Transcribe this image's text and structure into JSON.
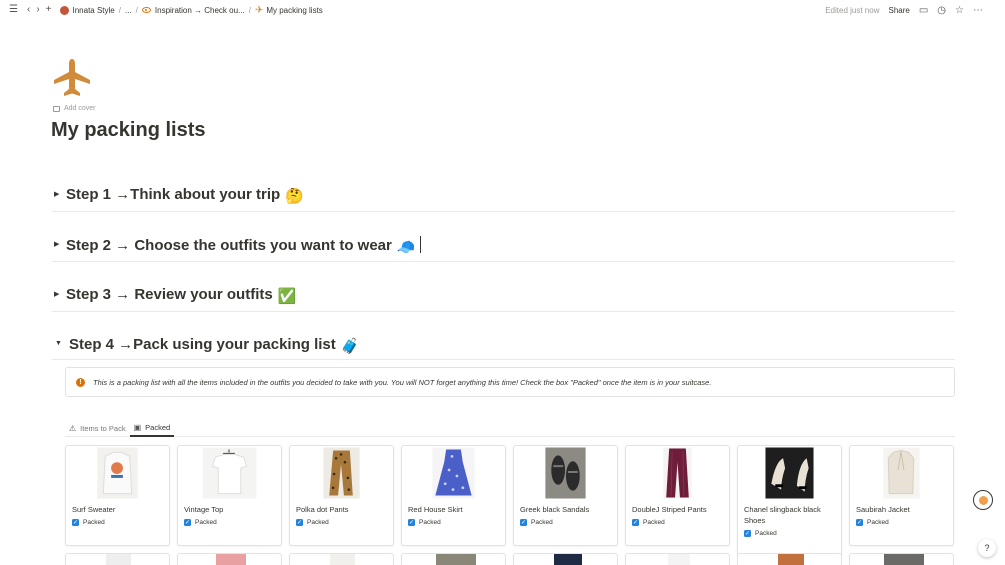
{
  "topbar": {
    "breadcrumbs": [
      "Innata Style",
      "...",
      "Inspiration → Check ou...",
      "My packing lists"
    ],
    "edited": "Edited just now",
    "share": "Share"
  },
  "page": {
    "icon": "airplane-icon",
    "add_cover": "Add cover",
    "title": "My packing lists"
  },
  "toggles": [
    {
      "label": "Step 1 →Think about your trip",
      "emoji": "🤔",
      "open": false
    },
    {
      "label": "Step 2 → Choose the outfits you want to wear",
      "emoji": "🧢",
      "open": false
    },
    {
      "label": "Step 3 → Review your outfits",
      "emoji": "✅",
      "open": false
    },
    {
      "label": "Step 4 →Pack using your packing list",
      "emoji": "🧳",
      "open": true
    }
  ],
  "callout": {
    "text": "This is a packing list with all the items included in the outfits you decided to take with you. You will NOT forget anything this time! Check the box \"Packed\" once the item is in your suitcase."
  },
  "tabs": [
    {
      "label": "Items to Pack",
      "active": false
    },
    {
      "label": "Packed",
      "active": true
    }
  ],
  "cards": [
    {
      "name": "Surf Sweater",
      "packed_label": "Packed",
      "packed": true
    },
    {
      "name": "Vintage Top",
      "packed_label": "Packed",
      "packed": true
    },
    {
      "name": "Polka dot Pants",
      "packed_label": "Packed",
      "packed": true
    },
    {
      "name": "Red House Skirt",
      "packed_label": "Packed",
      "packed": true
    },
    {
      "name": "Greek black Sandals",
      "packed_label": "Packed",
      "packed": true
    },
    {
      "name": "DoubleJ Striped Pants",
      "packed_label": "Packed",
      "packed": true
    },
    {
      "name": "Chanel slingback black Shoes",
      "packed_label": "Packed",
      "packed": true
    },
    {
      "name": "Saubirah Jacket",
      "packed_label": "Packed",
      "packed": true
    }
  ],
  "help": "?",
  "colors": {
    "accent_orange": "#d9730d",
    "checkbox_blue": "#2383e2",
    "plane": "#d08b3b"
  }
}
